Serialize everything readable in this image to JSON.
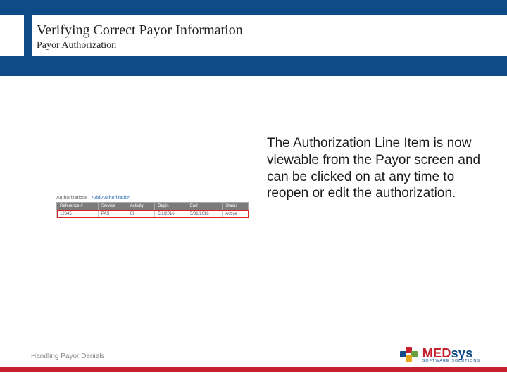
{
  "header": {
    "title": "Verifying Correct Payor Information",
    "subtitle": "Payor Authorization"
  },
  "body": {
    "paragraph": "The Authorization Line Item is now viewable from the Payor screen and can be clicked on at any time to reopen or edit the authorization."
  },
  "auth": {
    "section_label": "Authorizations",
    "add_link": "Add Authorization",
    "columns": [
      "Reference #",
      "Service",
      "Activity",
      "Begin",
      "End",
      "Status"
    ],
    "rows": [
      {
        "ref": "12345",
        "service": "PAS",
        "activity": "01",
        "begin": "5/1/2016",
        "end": "5/31/2016",
        "status": "Active"
      }
    ]
  },
  "footer": {
    "left_text": "Handling Payor Denials",
    "logo": {
      "brand_left": "MED",
      "brand_right": "sys",
      "tagline": "SOFTWARE SOLUTIONS"
    }
  }
}
